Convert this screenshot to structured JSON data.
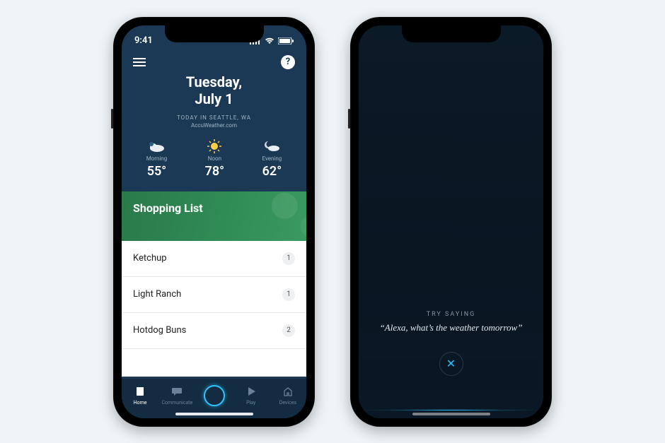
{
  "statusbar": {
    "time": "9:41"
  },
  "header": {
    "day_name": "Tuesday,",
    "day_date": "July 1",
    "weather_location": "TODAY IN SEATTLE, WA",
    "weather_source": "AccuWeather.com"
  },
  "forecast": [
    {
      "label": "Morning",
      "temp": "55°",
      "icon": "cloud"
    },
    {
      "label": "Noon",
      "temp": "78°",
      "icon": "sun"
    },
    {
      "label": "Evening",
      "temp": "62°",
      "icon": "moon-cloud"
    }
  ],
  "shopping": {
    "title": "Shopping List",
    "items": [
      {
        "name": "Ketchup",
        "count": "1"
      },
      {
        "name": "Light Ranch",
        "count": "1"
      },
      {
        "name": "Hotdog Buns",
        "count": "2"
      }
    ]
  },
  "nav": {
    "home": "Home",
    "communicate": "Communicate",
    "play": "Play",
    "devices": "Devices"
  },
  "voice": {
    "try_label": "TRY SAYING",
    "suggestion": "“Alexa, what’s the weather tomorrow”"
  },
  "icons": {
    "help": "?",
    "close": "✕"
  }
}
